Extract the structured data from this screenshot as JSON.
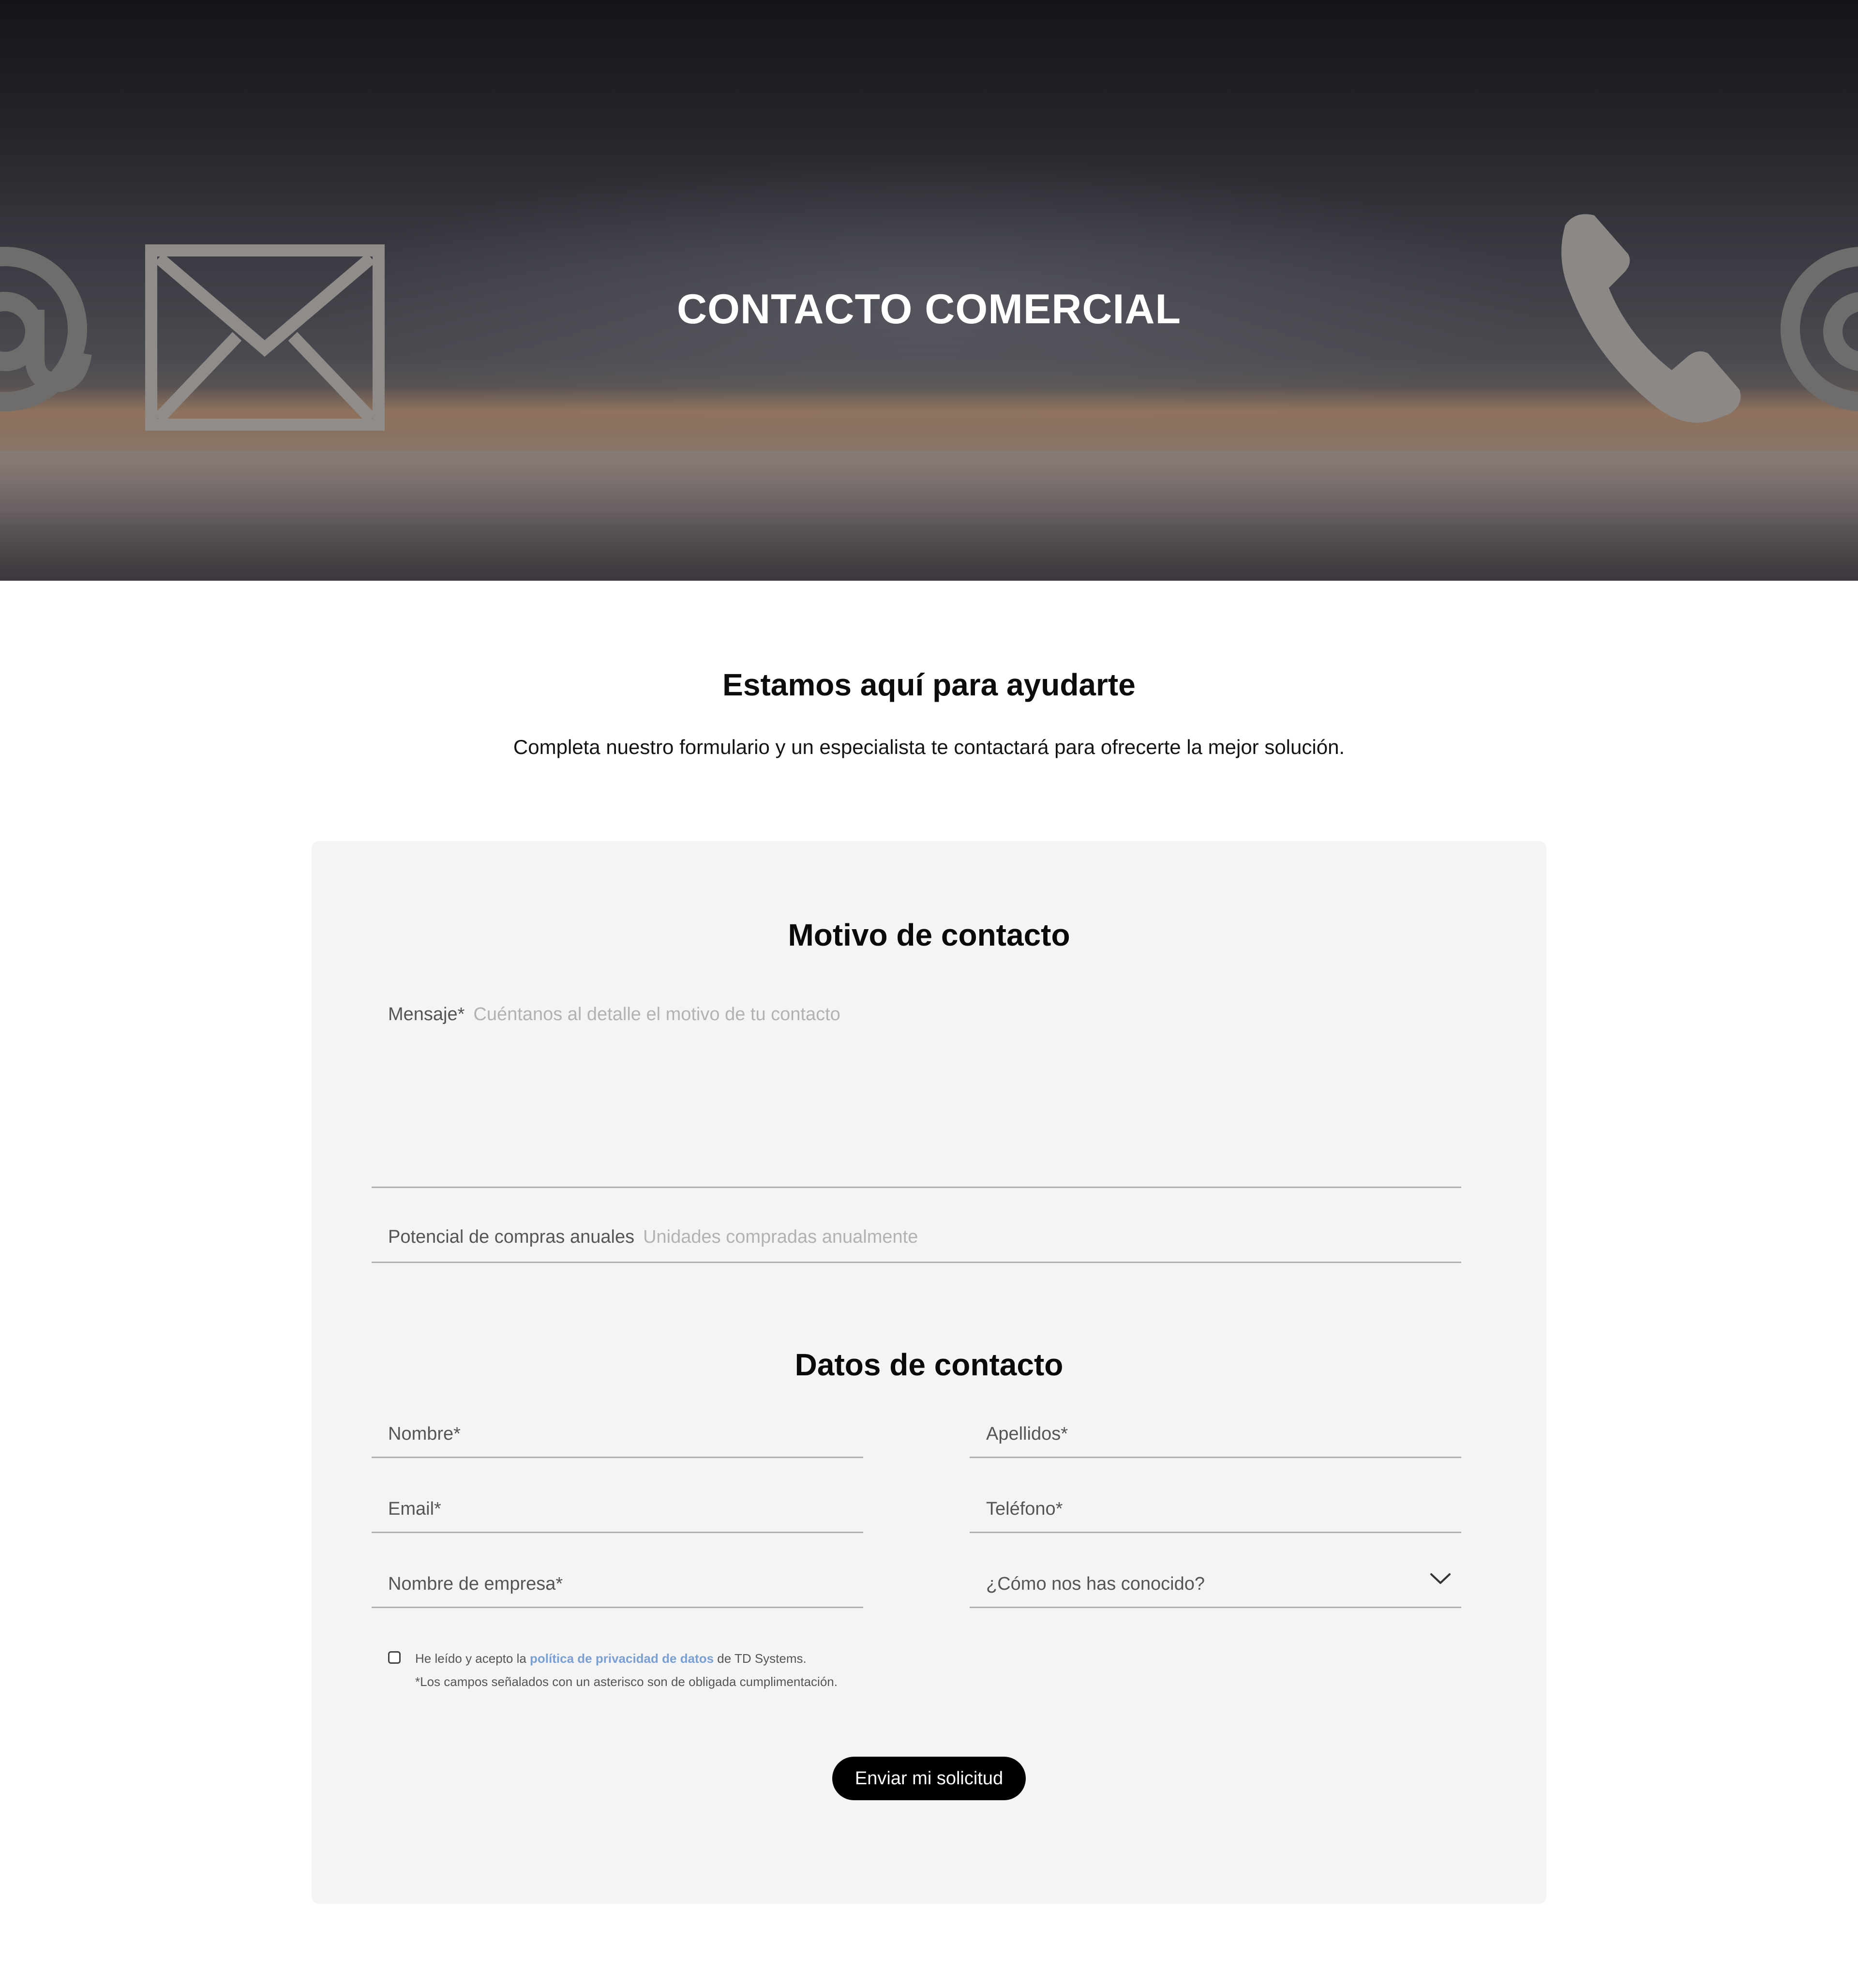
{
  "hero": {
    "title": "CONTACTO COMERCIAL",
    "icons": [
      "at-sign-icon",
      "envelope-icon",
      "phone-icon",
      "at-sign-icon"
    ]
  },
  "intro": {
    "title": "Estamos aquí para ayudarte",
    "subtitle": "Completa nuestro formulario y un especialista te contactará para ofrecerte la mejor solución."
  },
  "form": {
    "motivo": {
      "title": "Motivo de contacto",
      "message_label": "Mensaje*",
      "message_placeholder": "Cuéntanos al detalle el motivo de tu contacto",
      "purchases_label": "Potencial de compras anuales",
      "purchases_placeholder": "Unidades compradas anualmente"
    },
    "datos": {
      "title": "Datos de contacto",
      "nombre": "Nombre*",
      "apellidos": "Apellidos*",
      "email": "Email*",
      "telefono": "Teléfono*",
      "empresa": "Nombre de empresa*",
      "como_nos_conociste": "¿Cómo nos has conocido?"
    },
    "consent": {
      "prefix": "He leído y acepto la",
      "link": "política de privacidad de datos",
      "suffix": "de TD Systems.",
      "required_note": "*Los campos señalados con un asterisco son de obligada cumplimentación.",
      "link_color": "#7a9fd1"
    },
    "submit_label": "Enviar mi solicitud"
  }
}
